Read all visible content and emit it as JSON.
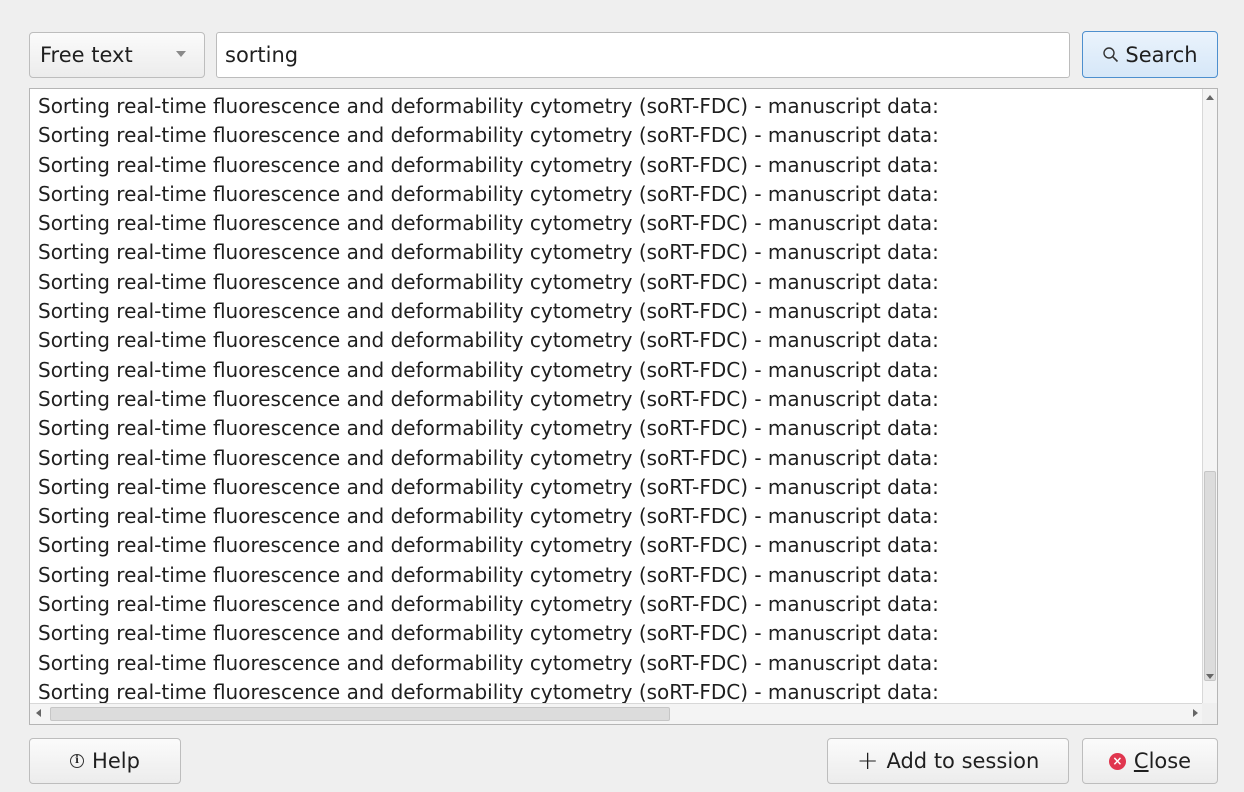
{
  "search_bar": {
    "mode": "Free text",
    "query": "sorting",
    "search_label": "Search"
  },
  "results": {
    "rows": [
      "Sorting real-time fluorescence and deformability cytometry (soRT-FDC) - manuscript data: ",
      "Sorting real-time fluorescence and deformability cytometry (soRT-FDC) - manuscript data: ",
      "Sorting real-time fluorescence and deformability cytometry (soRT-FDC) - manuscript data: ",
      "Sorting real-time fluorescence and deformability cytometry (soRT-FDC) - manuscript data: ",
      "Sorting real-time fluorescence and deformability cytometry (soRT-FDC) - manuscript data: ",
      "Sorting real-time fluorescence and deformability cytometry (soRT-FDC) - manuscript data: ",
      "Sorting real-time fluorescence and deformability cytometry (soRT-FDC) - manuscript data: ",
      "Sorting real-time fluorescence and deformability cytometry (soRT-FDC) - manuscript data: ",
      "Sorting real-time fluorescence and deformability cytometry (soRT-FDC) - manuscript data: ",
      "Sorting real-time fluorescence and deformability cytometry (soRT-FDC) - manuscript data: ",
      "Sorting real-time fluorescence and deformability cytometry (soRT-FDC) - manuscript data: ",
      "Sorting real-time fluorescence and deformability cytometry (soRT-FDC) - manuscript data: ",
      "Sorting real-time fluorescence and deformability cytometry (soRT-FDC) - manuscript data: ",
      "Sorting real-time fluorescence and deformability cytometry (soRT-FDC) - manuscript data: ",
      "Sorting real-time fluorescence and deformability cytometry (soRT-FDC) - manuscript data: ",
      "Sorting real-time fluorescence and deformability cytometry (soRT-FDC) - manuscript data: ",
      "Sorting real-time fluorescence and deformability cytometry (soRT-FDC) - manuscript data: ",
      "Sorting real-time fluorescence and deformability cytometry (soRT-FDC) - manuscript data: ",
      "Sorting real-time fluorescence and deformability cytometry (soRT-FDC) - manuscript data: ",
      "Sorting real-time fluorescence and deformability cytometry (soRT-FDC) - manuscript data: ",
      "Sorting real-time fluorescence and deformability cytometry (soRT-FDC) - manuscript data: "
    ]
  },
  "footer": {
    "help_label": "Help",
    "add_label": "Add to session",
    "close_label_first": "C",
    "close_label_rest": "lose"
  },
  "colors": {
    "accent_border": "#4d8fce",
    "close_icon": "#e0364f"
  }
}
